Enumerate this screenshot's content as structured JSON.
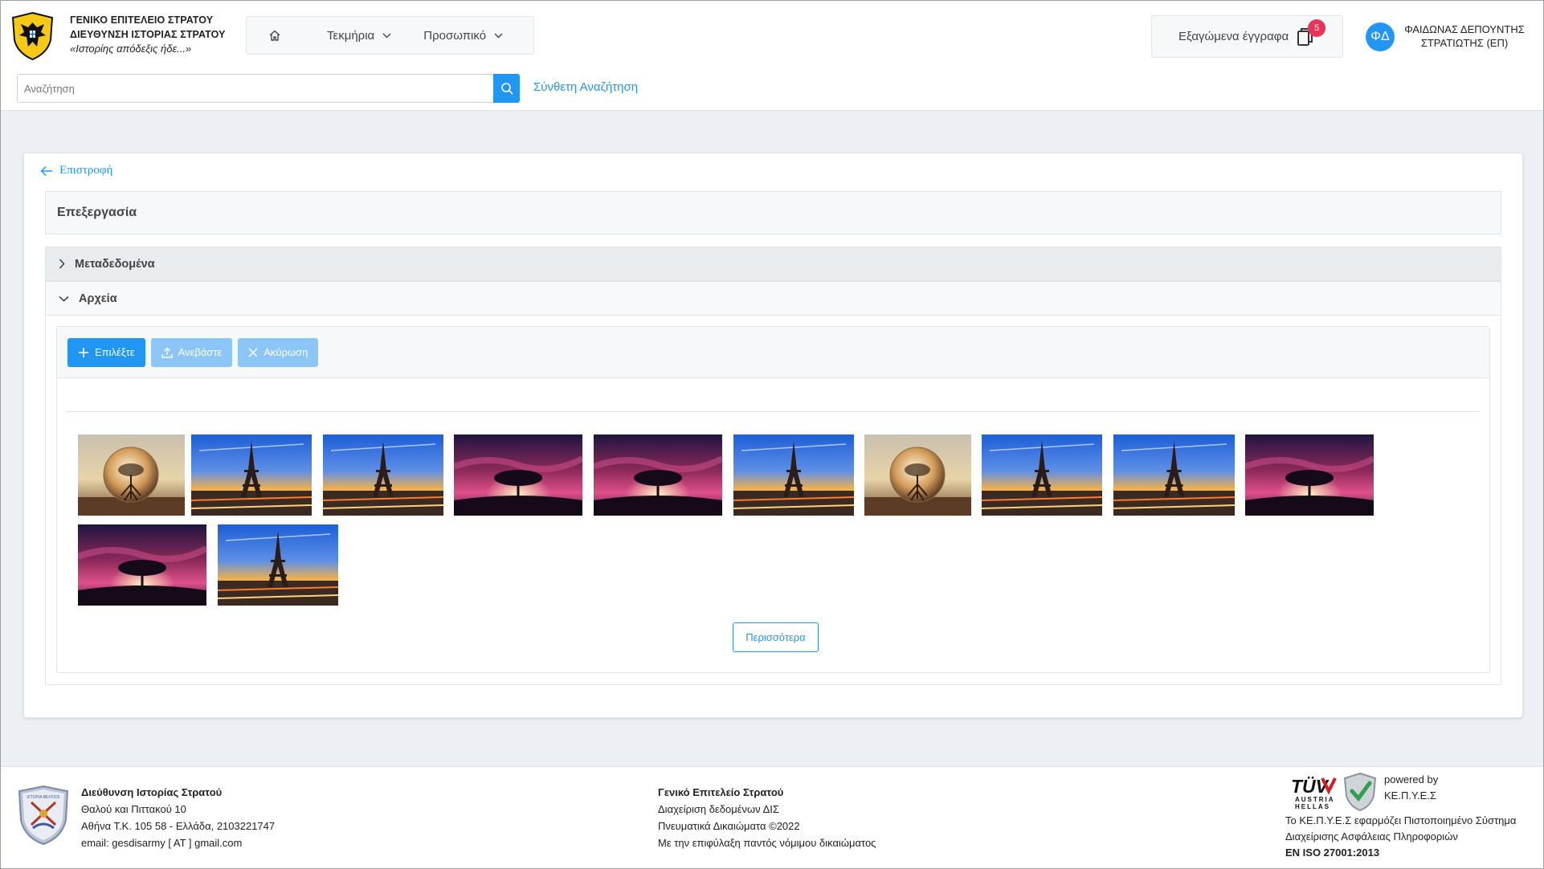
{
  "header": {
    "org_line1": "ΓΕΝΙΚΟ ΕΠΙΤΕΛΕΙΟ ΣΤΡΑΤΟΥ",
    "org_line2": "ΔΙΕΥΘΥΝΣΗ ΙΣΤΟΡΙΑΣ ΣΤΡΑΤΟΥ",
    "motto": "«Ιστορίης απόδεξις ήδε...»",
    "nav": {
      "home_icon": "home-icon",
      "items": [
        {
          "label": "Τεκμήρια"
        },
        {
          "label": "Προσωπικό"
        }
      ]
    },
    "export": {
      "label": "Εξαγώμενα έγγραφα",
      "count": "5"
    },
    "user": {
      "initials": "ΦΔ",
      "name_line1": "ΦΑΙΔΩΝΑΣ ΔΕΠΟΥΝΤΗΣ",
      "name_line2": "ΣΤΡΑΤΙΩΤΗΣ (ΕΠ)"
    },
    "search": {
      "placeholder": "Αναζήτηση",
      "value": "",
      "advanced_label": "Σύνθετη Αναζήτηση"
    }
  },
  "main": {
    "back_label": "Επιστροφή",
    "title": "Επεξεργασία",
    "accordion": [
      {
        "label": "Μεταδεδομένα",
        "expanded": false
      },
      {
        "label": "Αρχεία",
        "expanded": true
      }
    ],
    "uploader": {
      "choose_label": "Επιλέξτε",
      "upload_label": "Ανεβάστε",
      "cancel_label": "Ακύρωση",
      "more_label": "Περισσότερα"
    },
    "images": [
      {
        "subject": "crystal-ball"
      },
      {
        "subject": "eiffel-tower"
      },
      {
        "subject": "eiffel-tower"
      },
      {
        "subject": "tree-sunset"
      },
      {
        "subject": "tree-sunset"
      },
      {
        "subject": "eiffel-tower"
      },
      {
        "subject": "crystal-ball"
      },
      {
        "subject": "eiffel-tower"
      },
      {
        "subject": "eiffel-tower"
      },
      {
        "subject": "tree-sunset"
      },
      {
        "subject": "tree-sunset"
      },
      {
        "subject": "eiffel-tower"
      }
    ]
  },
  "footer": {
    "col1": {
      "title": "Διεύθυνση Ιστορίας Στρατού",
      "line1": "Θαλού και Πιττακού 10",
      "line2": "Αθήνα Τ.Κ. 105 58 - Ελλάδα, 2103221747",
      "line3": "email: gesdisarmy [ AT ] gmail.com"
    },
    "col2": {
      "title": "Γενικό Επιτελείο Στρατού",
      "line1": "Διαχείριση δεδομένων ΔΙΣ",
      "line2": "Πνευματικά Δικαιώματα ©2022",
      "line3": "Με την επιφύλαξη παντός νόμιμου δικαιώματος"
    },
    "tuv": {
      "word": "TÜV",
      "line1": "AUSTRIA",
      "line2": "HELLAS"
    },
    "logo_text": "ΙΣΤΟΡΙΑ ΒΕΛΤΙΟΣ",
    "powered_line1": "powered by",
    "powered_line2": "ΚΕ.Π.Υ.Ε.Σ",
    "iso_line1": "Το ΚΕ.Π.Υ.Ε.Σ εφαρμόζει Πιστοποιημένο Σύστημα",
    "iso_line2": "Διαχείρισης Ασφάλειας Πληροφοριών",
    "iso_line3": "EN ISO 27001:2013"
  },
  "colors": {
    "accent": "#2196f3",
    "badge": "#e8345a",
    "page_bg": "#eceff3"
  }
}
